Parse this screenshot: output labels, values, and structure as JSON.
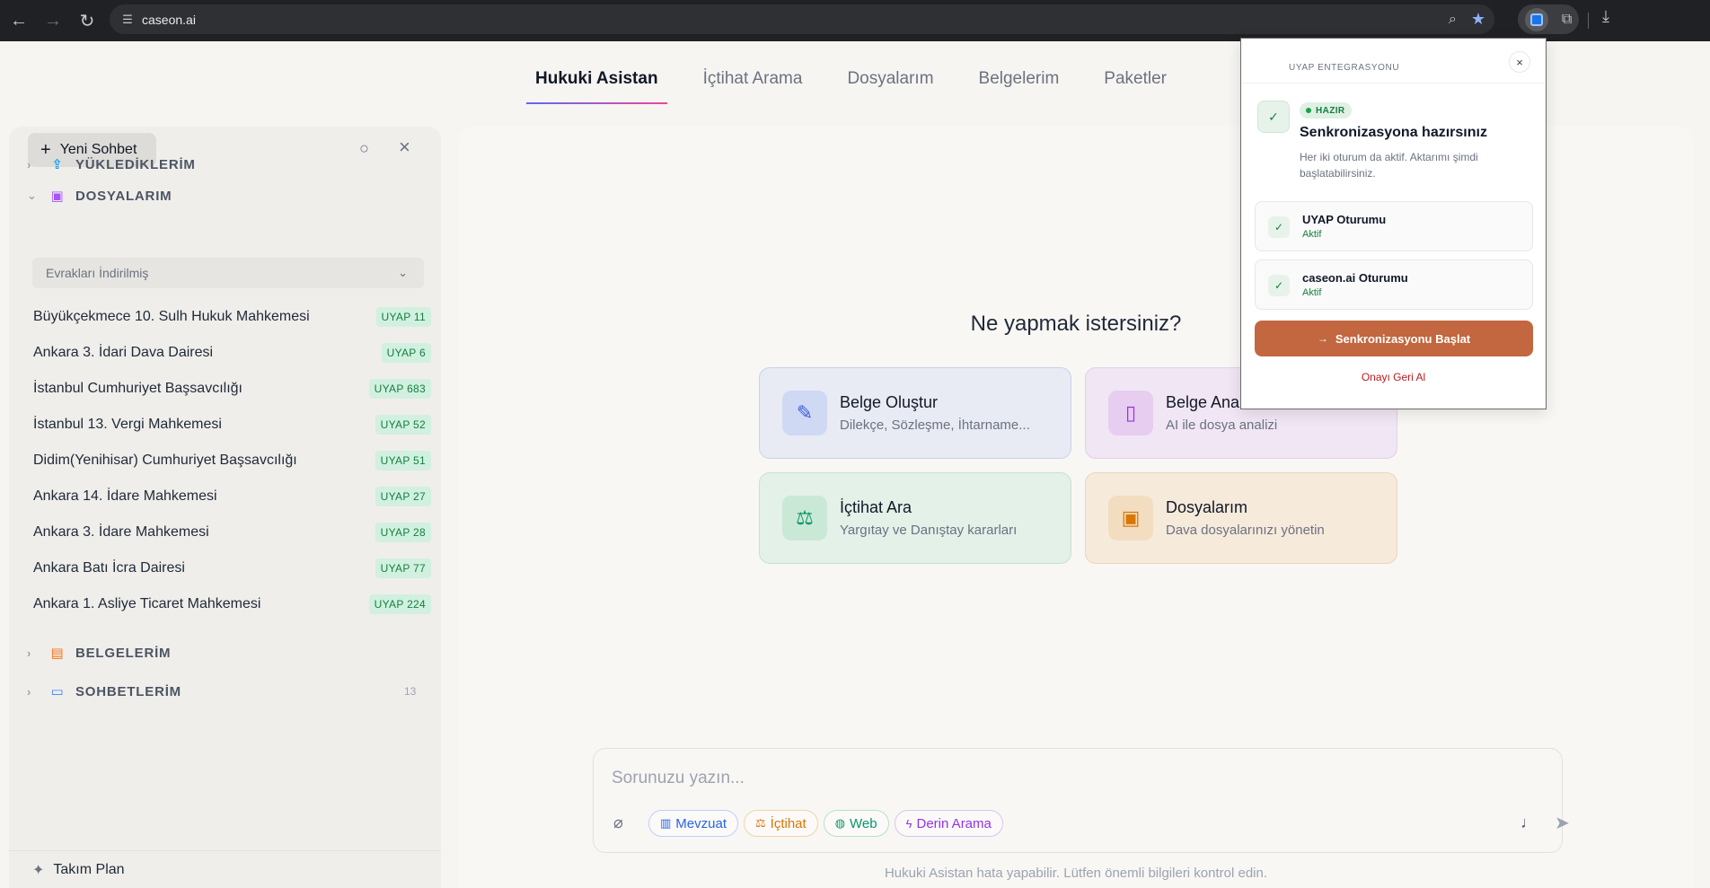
{
  "browser": {
    "url": "caseon.ai"
  },
  "tabs": [
    {
      "label": "Hukuki Asistan",
      "active": true
    },
    {
      "label": "İçtihat Arama"
    },
    {
      "label": "Dosyalarım"
    },
    {
      "label": "Belgelerim"
    },
    {
      "label": "Paketler"
    }
  ],
  "sidebar": {
    "new_chat_label": "Yeni Sohbet",
    "sections": {
      "uploads": "YÜKLEDİKLERİM",
      "cases": "DOSYALARIM",
      "documents": "BELGELERİM",
      "chats": "SOHBETLERİM",
      "chats_count": "13"
    },
    "filter_selected": "Evrakları İndirilmiş",
    "courts": [
      {
        "name": "Büyükçekmece 10. Sulh Hukuk Mahkemesi",
        "badge": "UYAP 11"
      },
      {
        "name": "Ankara 3. İdari Dava Dairesi",
        "badge": "UYAP 6"
      },
      {
        "name": "İstanbul Cumhuriyet Başsavcılığı",
        "badge": "UYAP 683"
      },
      {
        "name": "İstanbul 13. Vergi Mahkemesi",
        "badge": "UYAP 52"
      },
      {
        "name": "Didim(Yenihisar) Cumhuriyet Başsavcılığı",
        "badge": "UYAP 51"
      },
      {
        "name": "Ankara 14. İdare Mahkemesi",
        "badge": "UYAP 27"
      },
      {
        "name": "Ankara 3. İdare Mahkemesi",
        "badge": "UYAP 28"
      },
      {
        "name": "Ankara Batı İcra Dairesi",
        "badge": "UYAP 77"
      },
      {
        "name": "Ankara 1. Asliye Ticaret Mahkemesi",
        "badge": "UYAP 224"
      }
    ],
    "footer_label": "Takım Plan"
  },
  "main": {
    "headline": "Ne yapmak istersiniz?",
    "cards": [
      {
        "title": "Belge Oluştur",
        "subtitle": "Dilekçe, Sözleşme, İhtarname..."
      },
      {
        "title": "Belge Ana",
        "subtitle": "AI ile dosya analizi"
      },
      {
        "title": "İçtihat Ara",
        "subtitle": "Yargıtay ve Danıştay kararları"
      },
      {
        "title": "Dosyalarım",
        "subtitle": "Dava dosyalarınızı yönetin"
      }
    ],
    "composer": {
      "placeholder": "Sorunuzu yazın...",
      "chips": [
        "Mevzuat",
        "İçtihat",
        "Web",
        "Derin Arama"
      ]
    },
    "disclaimer": "Hukuki Asistan hata yapabilir. Lütfen önemli bilgileri kontrol edin."
  },
  "popup": {
    "title": "UYAP ENTEGRASYONU",
    "badge": "HAZIR",
    "heading": "Senkronizasyona hazırsınız",
    "description": "Her iki oturum da aktif. Aktarımı şimdi başlatabilirsiniz.",
    "sessions": [
      {
        "title": "UYAP Oturumu",
        "status": "Aktif"
      },
      {
        "title": "caseon.ai Oturumu",
        "status": "Aktif"
      }
    ],
    "start_button": "Senkronizasyonu Başlat",
    "revoke_link": "Onayı Geri Al"
  },
  "colors": {
    "accent": "#c2673f",
    "success": "#15803d",
    "revoke": "#b91c1c"
  }
}
